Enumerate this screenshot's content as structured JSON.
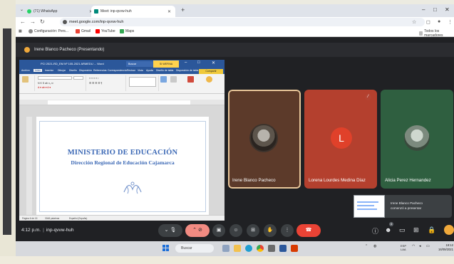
{
  "browser": {
    "tabs": [
      {
        "label": "(71) WhatsApp"
      },
      {
        "label": "Meet: inp-qvvw-huh"
      }
    ],
    "address": "meet.google.com/inp-qvvw-huh",
    "bookmarks": [
      {
        "label": "Configuración: Pers..."
      },
      {
        "label": "Gmail"
      },
      {
        "label": "YouTube"
      },
      {
        "label": "Maps"
      }
    ],
    "bookmarks_right": "Todos los marcadores"
  },
  "meet": {
    "presenter_title": "Irene Blanco Pacheco (Presentando)",
    "time": "4:12 p.m.",
    "meeting_code": "inp-qvvw-huh",
    "participants": [
      {
        "name": "Irene Blanco Pacheco"
      },
      {
        "name": "Lorena Lourdes Medina Díaz",
        "initial": "L"
      },
      {
        "name": "Alicia Perez Hernandez"
      }
    ],
    "notification": {
      "line1": "Irene Blanco Pacheco",
      "line2": "comenzó a presentar"
    },
    "people_count": "4"
  },
  "word": {
    "title_doc": "PCI 2021-RD_EM Nº 105-2021 ARMEDU ... Word",
    "search_placeholder": "Buscar",
    "user_label": "SI WEFINA",
    "share_label": "Compartir",
    "tabs": [
      "Archivo",
      "Inicio",
      "Insertar",
      "Dibujar",
      "Diseño",
      "Disposición",
      "Referencias",
      "Correspondencia",
      "Revisar",
      "Vista",
      "Ayuda",
      "Diseño de tabla",
      "Disposición de tabla"
    ],
    "doc_heading": "MINISTERIO DE EDUCACIÓN",
    "doc_subheading": "Dirección Regional de Educación Cajamarca",
    "status_left": "Página 6 de 15",
    "status_words": "3048 palabras",
    "status_lang": "Español (España)"
  },
  "taskbar": {
    "search_label": "Buscar",
    "lang": "ESP\nLAA",
    "time": "19:12",
    "date": "16/09/2021"
  },
  "colors": {
    "meet_bg": "#202124",
    "end_call": "#ea4335",
    "word_blue": "#2b579a",
    "doc_heading": "#3b68b5",
    "lorena_avatar": "#e0412a"
  }
}
